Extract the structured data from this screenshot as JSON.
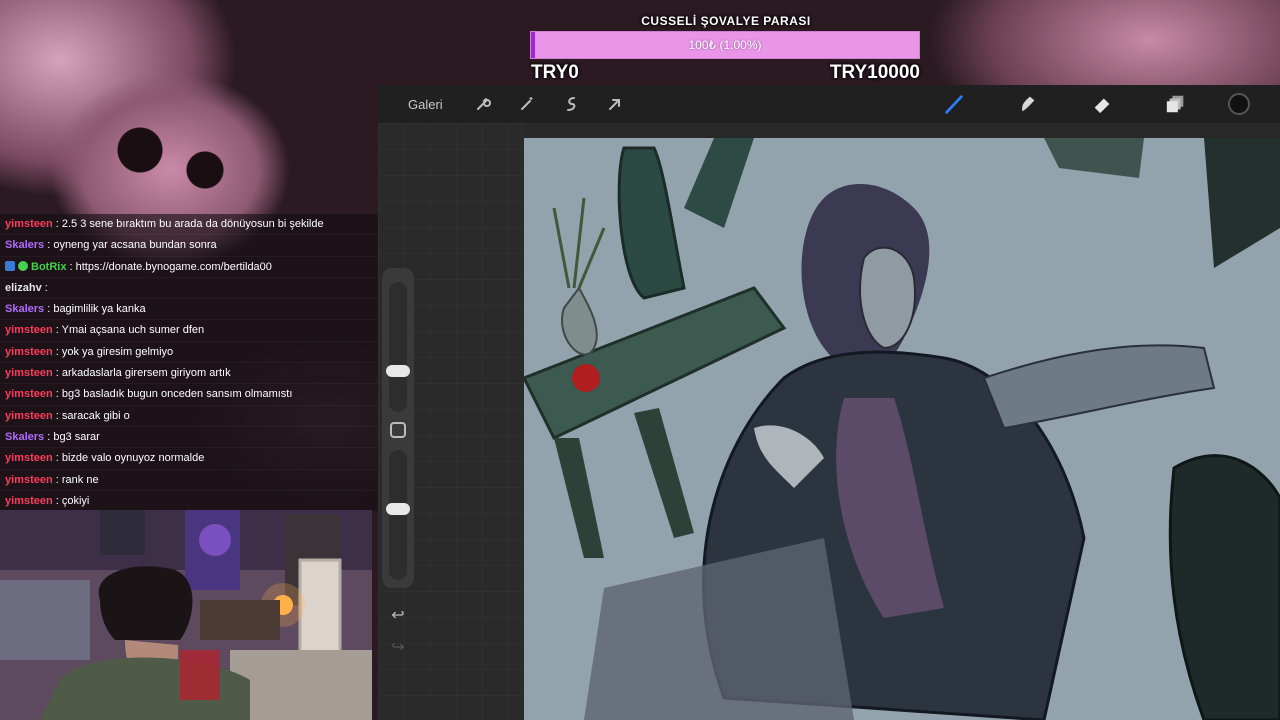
{
  "goal": {
    "title": "CUSSELİ ŞOVALYE PARASI",
    "progress_text": "100₺ (1.00%)",
    "progress_fraction": 0.01,
    "min_label": "TRY0",
    "max_label": "TRY10000",
    "bar_color": "#e995e8",
    "fill_color": "#9d2ad4"
  },
  "toolbar": {
    "gallery_label": "Galeri",
    "left_icons": [
      "wrench-icon",
      "magic-wand-icon",
      "selection-icon",
      "transform-arrow-icon"
    ],
    "right_icons": [
      "brush-icon",
      "smudge-icon",
      "eraser-icon",
      "layers-icon",
      "color-swatch"
    ],
    "active_tool_color": "#2f7bf5",
    "current_color": "#111111"
  },
  "chat": [
    {
      "user": "yimsteen",
      "color": "#ff3b5c",
      "message": ": 2.5 3 sene bıraktım bu arada da dönüyosun bi şekilde"
    },
    {
      "user": "Skalers",
      "color": "#b06cff",
      "message": ": oyneng yar acsana bundan sonra"
    },
    {
      "user": "BotRix",
      "color": "#43d14f",
      "message": ": https://donate.bynogame.com/bertilda00",
      "badges": true
    },
    {
      "user": "elizahv",
      "color": "#e6e6e6",
      "message": ": "
    },
    {
      "user": "Skalers",
      "color": "#b06cff",
      "message": ": bagimlilik ya kanka"
    },
    {
      "user": "yimsteen",
      "color": "#ff3b5c",
      "message": ": Ymai açsana uch sumer dfen"
    },
    {
      "user": "yimsteen",
      "color": "#ff3b5c",
      "message": ": yok ya giresim gelmiyo"
    },
    {
      "user": "yimsteen",
      "color": "#ff3b5c",
      "message": ": arkadaslarla girersem giriyom artık"
    },
    {
      "user": "yimsteen",
      "color": "#ff3b5c",
      "message": ": bg3 basladık bugun onceden sansım olmamıstı"
    },
    {
      "user": "yimsteen",
      "color": "#ff3b5c",
      "message": ": saracak gibi o"
    },
    {
      "user": "Skalers",
      "color": "#b06cff",
      "message": ": bg3 sarar"
    },
    {
      "user": "yimsteen",
      "color": "#ff3b5c",
      "message": ": bizde valo oynuyoz normalde"
    },
    {
      "user": "yimsteen",
      "color": "#ff3b5c",
      "message": ": rank ne"
    },
    {
      "user": "yimsteen",
      "color": "#ff3b5c",
      "message": ": çokiyi"
    }
  ],
  "sidebar": {
    "brush_size_level": 0.3,
    "opacity_level": 0.55
  }
}
